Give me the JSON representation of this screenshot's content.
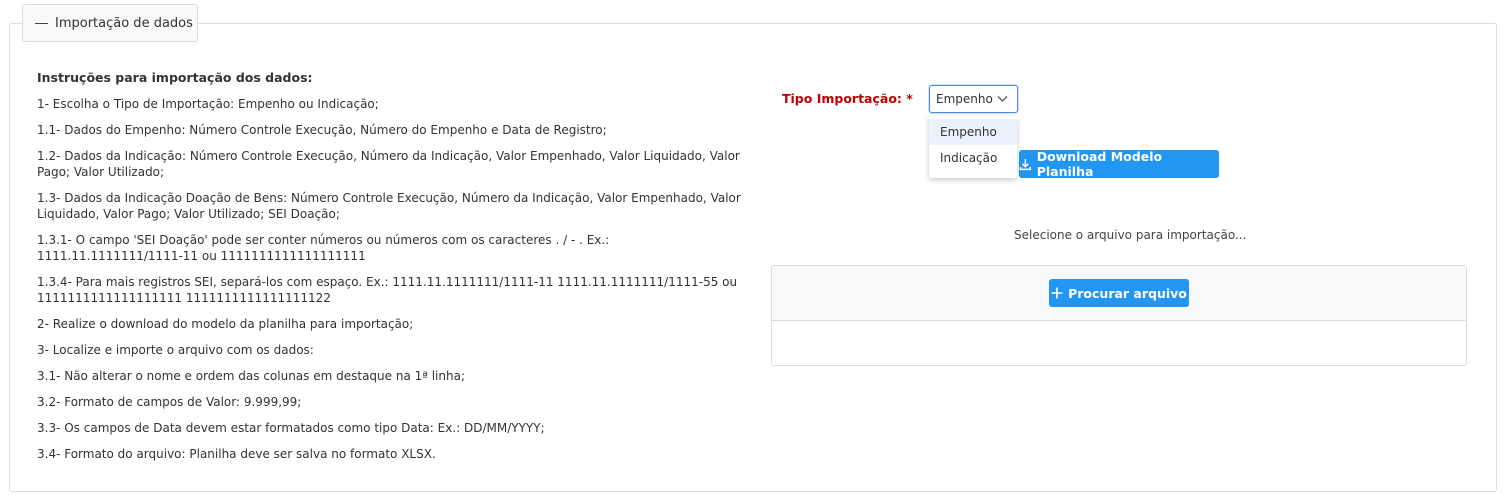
{
  "fieldset": {
    "legend": "Importação de dados"
  },
  "instructions": {
    "title": "Instruções para importação dos dados:",
    "items": [
      "1- Escolha o Tipo de Importação: Empenho ou Indicação;",
      "1.1- Dados do Empenho: Número Controle Execução, Número do Empenho e Data de Registro;",
      "1.2- Dados da Indicação: Número Controle Execução, Número da Indicação, Valor Empenhado, Valor Liquidado, Valor Pago; Valor Utilizado;",
      "1.3- Dados da Indicação Doação de Bens: Número Controle Execução, Número da Indicação, Valor Empenhado, Valor Liquidado, Valor Pago; Valor Utilizado; SEI Doação;",
      "1.3.1- O campo 'SEI Doação' pode ser conter números ou números com os caracteres . / - . Ex.: 1111.11.1111111/1111-11 ou 1111111111111111111",
      "1.3.4- Para mais registros SEI, separá-los com espaço. Ex.: 1111.11.1111111/1111-11 1111.11.1111111/1111-55 ou 1111111111111111111 1111111111111111122",
      "2- Realize o download do modelo da planilha para importação;",
      "3- Localize e importe o arquivo com os dados:",
      "3.1- Não alterar o nome e ordem das colunas em destaque na 1ª linha;",
      "3.2- Formato de campos de Valor: 9.999,99;",
      "3.3- Os campos de Data devem estar formatados como tipo Data: Ex.: DD/MM/YYYY;",
      "3.4- Formato do arquivo: Planilha deve ser salva no formato XLSX."
    ]
  },
  "form": {
    "tipo_label": "Tipo Importação: *",
    "tipo_selected": "Empenho",
    "tipo_options": [
      "Empenho",
      "Indicação"
    ],
    "download_label": "Download Modelo Planilha",
    "select_file_hint": "Selecione o arquivo para importação...",
    "browse_label": "Procurar arquivo"
  },
  "colors": {
    "primary": "#2196f3",
    "required_label": "#c00000",
    "select_focus_border": "#4a90d9"
  },
  "icons": {
    "legend": "minus-icon",
    "select": "chevron-down-icon",
    "download": "download-icon",
    "browse": "plus-icon"
  }
}
